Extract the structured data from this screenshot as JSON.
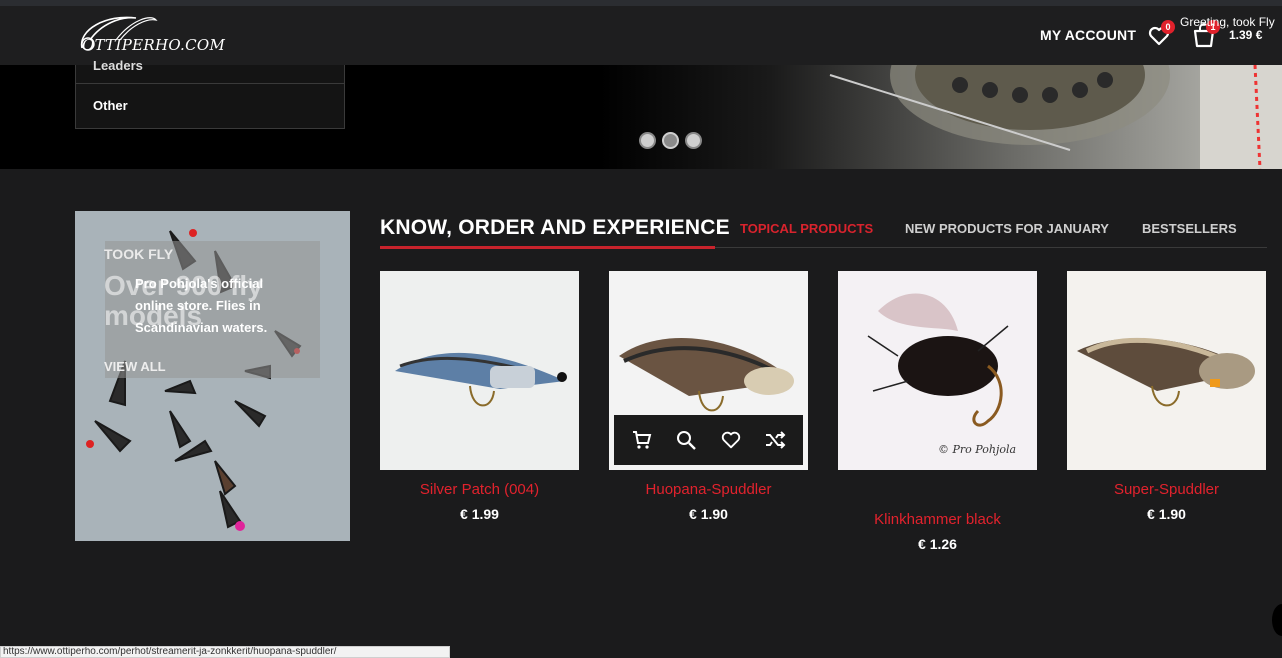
{
  "header": {
    "logo_text": "OTTIPERHO.COM",
    "my_account": "MY ACCOUNT",
    "wishlist_count": "0",
    "cart_count": "1",
    "greeting": "Greeting, took Fly",
    "cart_total": "1.39 €"
  },
  "category_menu": {
    "cut_item": "Leaders",
    "other": "Other"
  },
  "hero": {
    "slides": [
      "slide-1",
      "slide-2",
      "slide-3"
    ],
    "active_slide": 2
  },
  "promo": {
    "kicker": "TOOK FLY",
    "big_text": "Over 900 fly models",
    "text": "Pro Pohjola's official online store. Flies in Scandinavian waters.",
    "link": "VIEW ALL"
  },
  "section": {
    "title": "KNOW, ORDER AND EXPERIENCE",
    "tabs": [
      {
        "label": "TOPICAL PRODUCTS",
        "active": true
      },
      {
        "label": "NEW PRODUCTS FOR JANUARY",
        "active": false
      },
      {
        "label": "BESTSELLERS",
        "active": false
      }
    ]
  },
  "products": [
    {
      "name": "Silver Patch (004)",
      "price": "€ 1.99"
    },
    {
      "name": "Huopana-Spuddler",
      "price": "€ 1.90"
    },
    {
      "name": "Klinkhammer black",
      "price": "€ 1.26",
      "watermark": "© Pro Pohjola"
    },
    {
      "name": "Super-Spuddler",
      "price": "€ 1.90"
    }
  ],
  "product_actions": [
    "cart-icon",
    "search-icon",
    "heart-icon",
    "shuffle-icon"
  ],
  "status_bar": "https://www.ottiperho.com/perhot/streamerit-ja-zonkkerit/huopana-spuddler/",
  "colors": {
    "accent": "#d9232d",
    "background": "#1b1b1c",
    "header": "#1e1e1f"
  }
}
